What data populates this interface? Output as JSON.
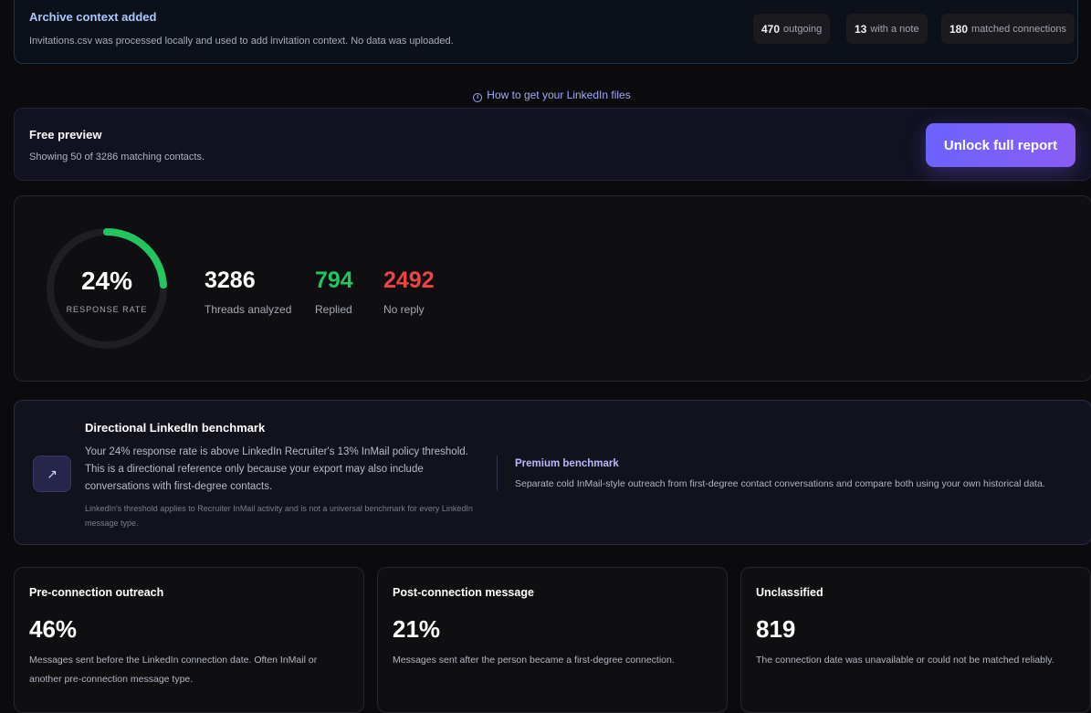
{
  "archive": {
    "title": "Archive context added",
    "description": "Invitations.csv was processed locally and used to add invitation context. No data was uploaded.",
    "stats": [
      {
        "value": "470",
        "label": "outgoing"
      },
      {
        "value": "13",
        "label": "with a note"
      },
      {
        "value": "180",
        "label": "matched connections"
      }
    ]
  },
  "howto": {
    "icon": "info-icon",
    "label": "How to get your LinkedIn files"
  },
  "preview": {
    "title": "Free preview",
    "description": "Showing 50 of 3286 matching contacts.",
    "unlock_label": "Unlock full report"
  },
  "rate": {
    "percent_label": "24%",
    "percent_value": 24,
    "caption": "RESPONSE RATE",
    "gauge_color": "#22c55e",
    "metrics": [
      {
        "value": "3286",
        "label": "Threads analyzed",
        "color": "#ffffff"
      },
      {
        "value": "794",
        "label": "Replied",
        "color": "#22c55e"
      },
      {
        "value": "2492",
        "label": "No reply",
        "color": "#ef4444"
      }
    ]
  },
  "benchmark": {
    "icon": "trend-arrow-icon",
    "title": "Directional LinkedIn benchmark",
    "body": "Your 24% response rate is above LinkedIn Recruiter's 13% InMail policy threshold. This is a directional reference only because your export may also include conversations with first-degree contacts.",
    "note": "LinkedIn's threshold applies to Recruiter InMail activity and is not a universal benchmark for every LinkedIn message type.",
    "premium_title": "Premium benchmark",
    "premium_description": "Separate cold InMail-style outreach from first-degree contact conversations and compare both using your own historical data."
  },
  "categories": [
    {
      "title": "Pre-connection outreach",
      "value": "46%",
      "description": "Messages sent before the LinkedIn connection date. Often InMail or another pre-connection message type."
    },
    {
      "title": "Post-connection message",
      "value": "21%",
      "description": "Messages sent after the person became a first-degree connection."
    },
    {
      "title": "Unclassified",
      "value": "819",
      "description": "The connection date was unavailable or could not be matched reliably."
    }
  ]
}
